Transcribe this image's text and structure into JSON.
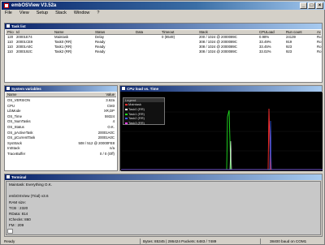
{
  "app": {
    "title": "embOSView V3.52a",
    "window_buttons": [
      "_",
      "□",
      "×"
    ]
  },
  "menu": [
    "File",
    "View",
    "Setup",
    "Stack",
    "Window",
    "?"
  ],
  "tasks_window": {
    "title": "Task list",
    "columns": [
      "Prio",
      "Id",
      "Name",
      "Status",
      "Data",
      "Timeout",
      "Stack",
      "CPULoad",
      "Run count",
      "Ac"
    ],
    "rows": [
      [
        "120",
        "20001E74",
        "Maintask",
        "Delay",
        "",
        "0 (8549)",
        "200 / 1024 @ 2000089C",
        "0.98%",
        "24139",
        "Ro"
      ],
      [
        "110",
        "20001CE9",
        "Task0 (RR)",
        "Ready",
        "",
        "",
        "308 / 1024 @ 2000089C",
        "33.49%",
        "919",
        "Ro"
      ],
      [
        "110",
        "20001A0C",
        "Task1 (RR)",
        "Ready",
        "",
        "",
        "308 / 1024 @ 2000089C",
        "33.45%",
        "923",
        "Ro"
      ],
      [
        "110",
        "2000192C",
        "Task2 (RR)",
        "Ready",
        "",
        "",
        "308 / 1024 @ 2000089C",
        "33.02%",
        "923",
        "Ro"
      ]
    ]
  },
  "vars_window": {
    "title": "System variables",
    "columns": [
      "Name",
      "Value"
    ],
    "rows": [
      [
        "OS_VERSION",
        "3.62a"
      ],
      [
        "CPU",
        "CM3"
      ],
      [
        "LibMode",
        "XR,DP"
      ],
      [
        "OS_Time",
        "59324"
      ],
      [
        "OS_NumTasks",
        "4"
      ],
      [
        "OS_Status",
        "O.K."
      ],
      [
        "OS_pActiveTask",
        "20001A0C"
      ],
      [
        "OS_pCurrentTask",
        "20001A0C"
      ],
      [
        "SysStack",
        "508 / 512 @ 20000FE8"
      ],
      [
        "IntStack",
        "n/a"
      ],
      [
        "TraceBuffer",
        "0 / 0 (Off)"
      ]
    ]
  },
  "cpu_window": {
    "title": "CPU load vs. Time",
    "legend_title": "Legend",
    "legend": [
      {
        "label": "Maintask",
        "color": "#ff3030"
      },
      {
        "label": "Task0 (RR)",
        "color": "#ffffff"
      },
      {
        "label": "Task1 (RR)",
        "color": "#20e020"
      },
      {
        "label": "Task2 (RR)",
        "color": "#4060ff"
      },
      {
        "label": "Task3 (RR)",
        "color": "#ff40ff"
      }
    ]
  },
  "terminal": {
    "title": "Terminal",
    "lines": [
      "Maintask: Everything O.K.",
      "",
      "embOSView (Trial) v3.6",
      "RAM size:",
      "TCB : 2320",
      "RData: 814",
      "IChecks: 860",
      "FM : 209"
    ]
  },
  "status": {
    "left": "Ready",
    "bytes": "Bytes: 85345 | 286424   Packets: 6483 / 7489",
    "baud": "38400 baud on COM1"
  }
}
